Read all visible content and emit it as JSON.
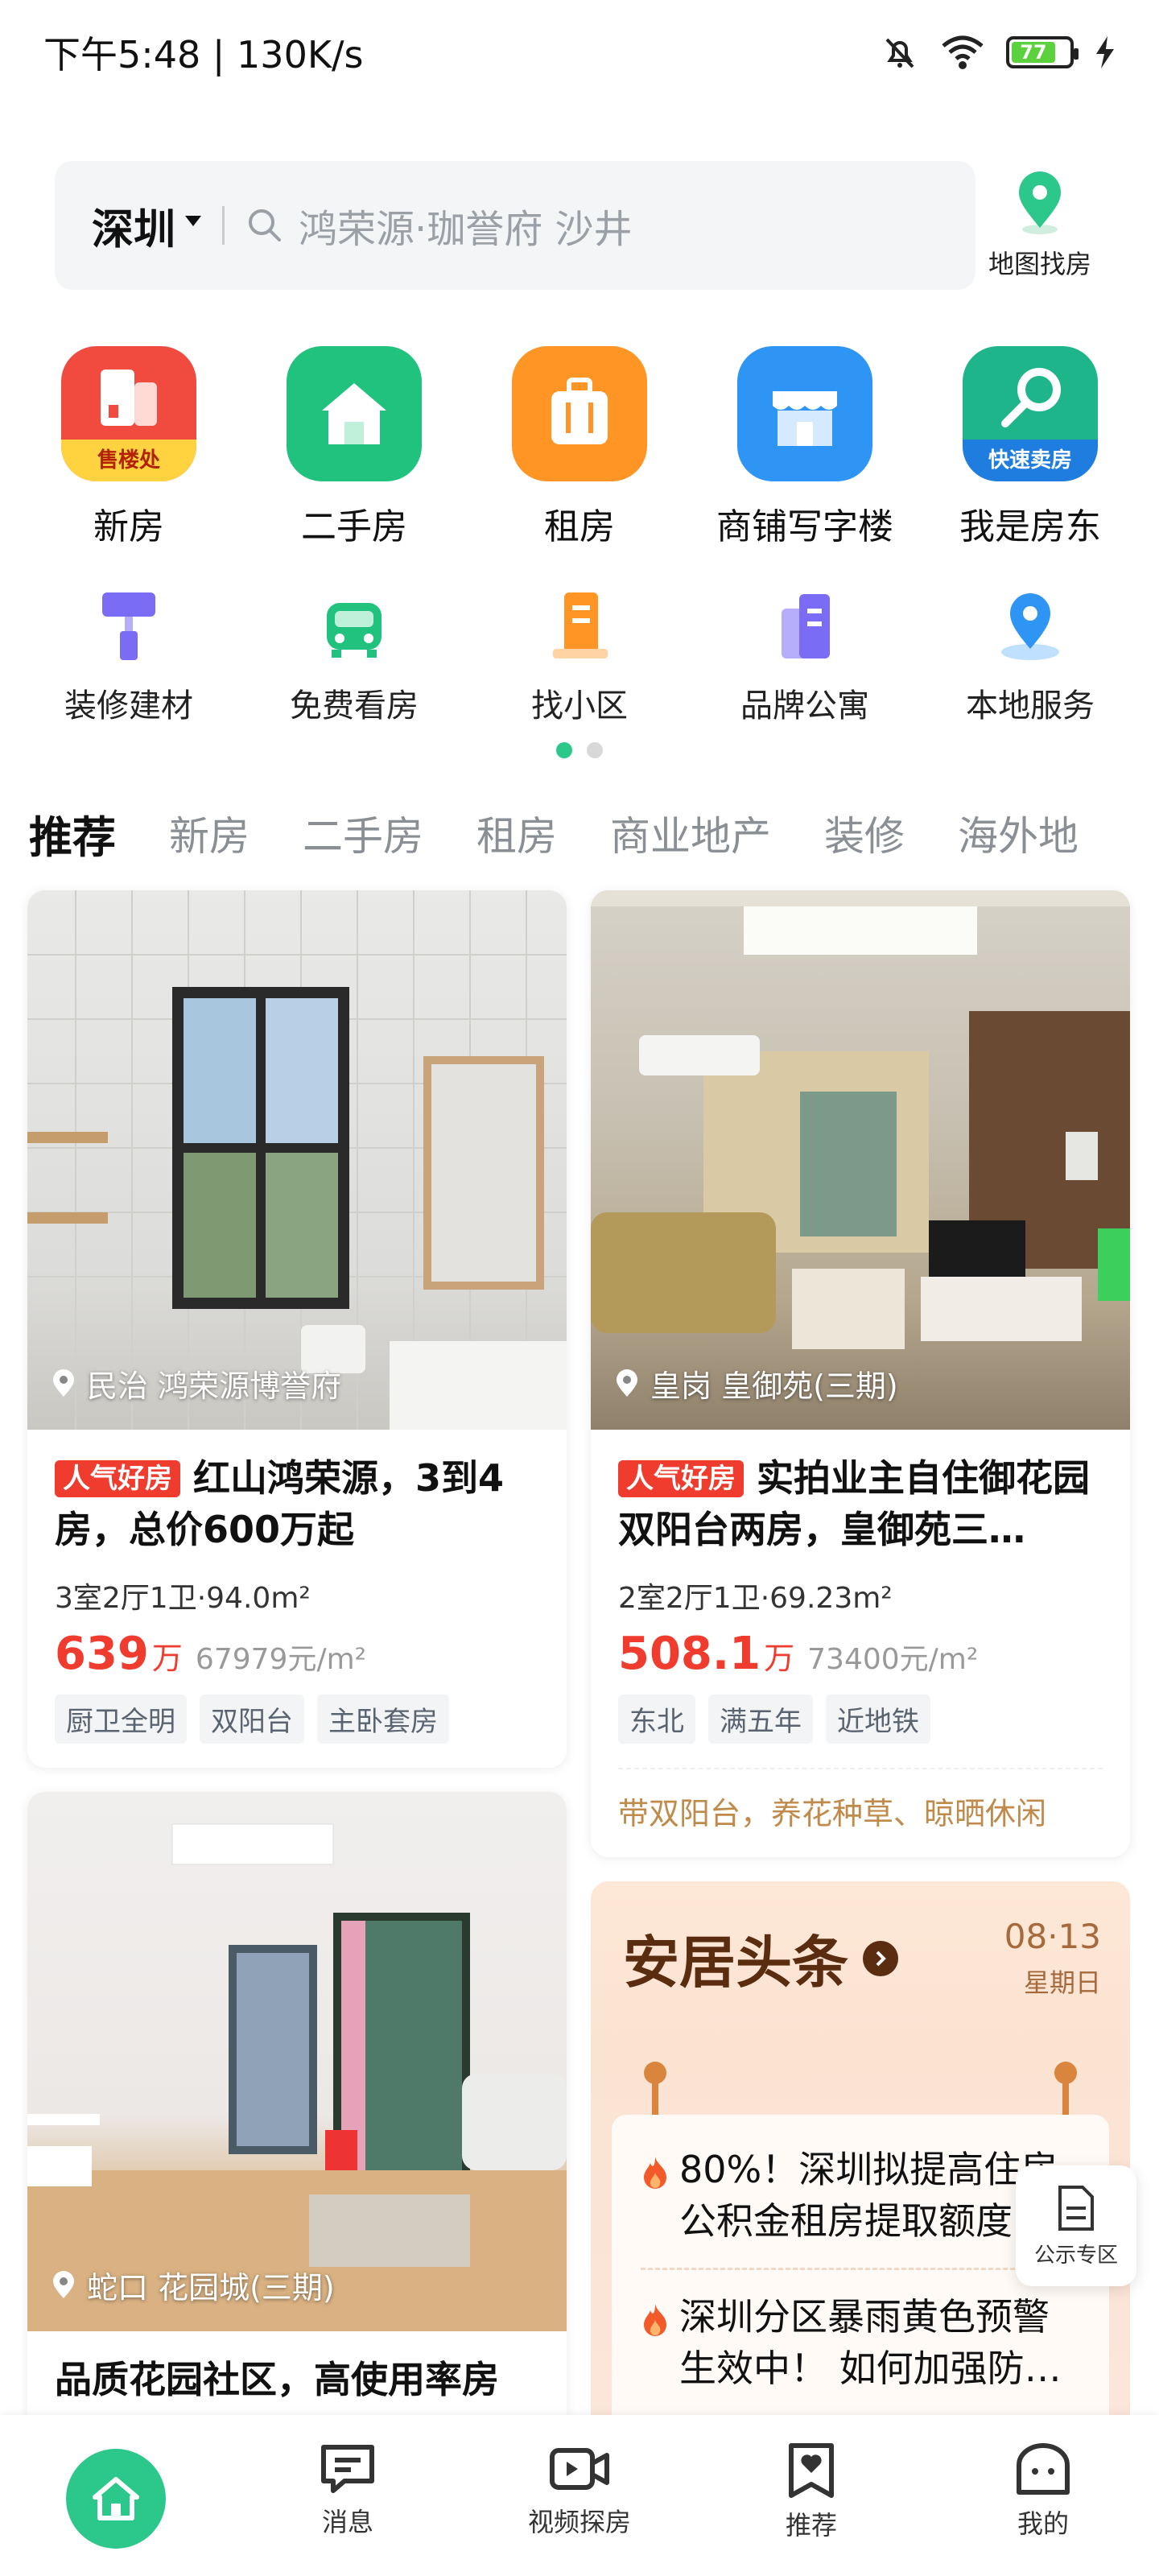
{
  "status_bar": {
    "time": "下午5:48 | 130K/s",
    "battery": "77"
  },
  "search": {
    "city": "深圳",
    "placeholder": "鸿荣源·珈誉府 沙井"
  },
  "map_find": {
    "label": "地图找房"
  },
  "categories": [
    {
      "label": "新房",
      "badge": "售楼处",
      "icon": "building-icon",
      "color": "#f04b3e"
    },
    {
      "label": "二手房",
      "badge": "",
      "icon": "house-icon",
      "color": "#20c27d"
    },
    {
      "label": "租房",
      "badge": "",
      "icon": "suitcase-icon",
      "color": "#ff9524"
    },
    {
      "label": "商铺写字楼",
      "badge": "",
      "icon": "shop-icon",
      "color": "#2f95f5"
    },
    {
      "label": "我是房东",
      "badge": "快速卖房",
      "icon": "key-icon",
      "color": "#1eb58a"
    }
  ],
  "services": [
    {
      "label": "装修建材",
      "icon": "paint-roller-icon"
    },
    {
      "label": "免费看房",
      "icon": "car-icon"
    },
    {
      "label": "找小区",
      "icon": "community-icon"
    },
    {
      "label": "品牌公寓",
      "icon": "apartment-icon"
    },
    {
      "label": "本地服务",
      "icon": "location-pin-icon"
    }
  ],
  "tabs": [
    "推荐",
    "新房",
    "二手房",
    "租房",
    "商业地产",
    "装修",
    "海外地"
  ],
  "listings": {
    "left_1": {
      "location": "民治 鸿荣源博誉府",
      "badge": "人气好房",
      "title": "红山鸿荣源，3到4房，总价600万起",
      "spec": "3室2厅1卫·94.0m²",
      "price": "639",
      "price_unit": "万",
      "price_per": "67979元/m²",
      "tags": [
        "厨卫全明",
        "双阳台",
        "主卧套房"
      ]
    },
    "right_1": {
      "location": "皇岗 皇御苑(三期)",
      "badge": "人气好房",
      "title": "实拍业主自住御花园双阳台两房，皇御苑三…",
      "spec": "2室2厅1卫·69.23m²",
      "price": "508.1",
      "price_unit": "万",
      "price_per": "73400元/m²",
      "tags": [
        "东北",
        "满五年",
        "近地铁"
      ],
      "slogan": "带双阳台，养花种草、晾晒休闲"
    },
    "left_2": {
      "location": "蛇口 花园城(三期)",
      "title": "品质花园社区，高使用率房"
    }
  },
  "headlines": {
    "title": "安居头条",
    "date": "08·13",
    "weekday": "星期日",
    "items": [
      "80%！深圳拟提高住房公积金租房提取额度",
      "深圳分区暴雨黄色预警生效中！ 如何加强防…"
    ]
  },
  "float_pub": {
    "label": "公示专区"
  },
  "bottom_nav": [
    {
      "label": "",
      "icon": "home-icon"
    },
    {
      "label": "消息",
      "icon": "message-icon"
    },
    {
      "label": "视频探房",
      "icon": "video-icon"
    },
    {
      "label": "推荐",
      "icon": "bookmark-heart-icon"
    },
    {
      "label": "我的",
      "icon": "profile-icon"
    }
  ]
}
